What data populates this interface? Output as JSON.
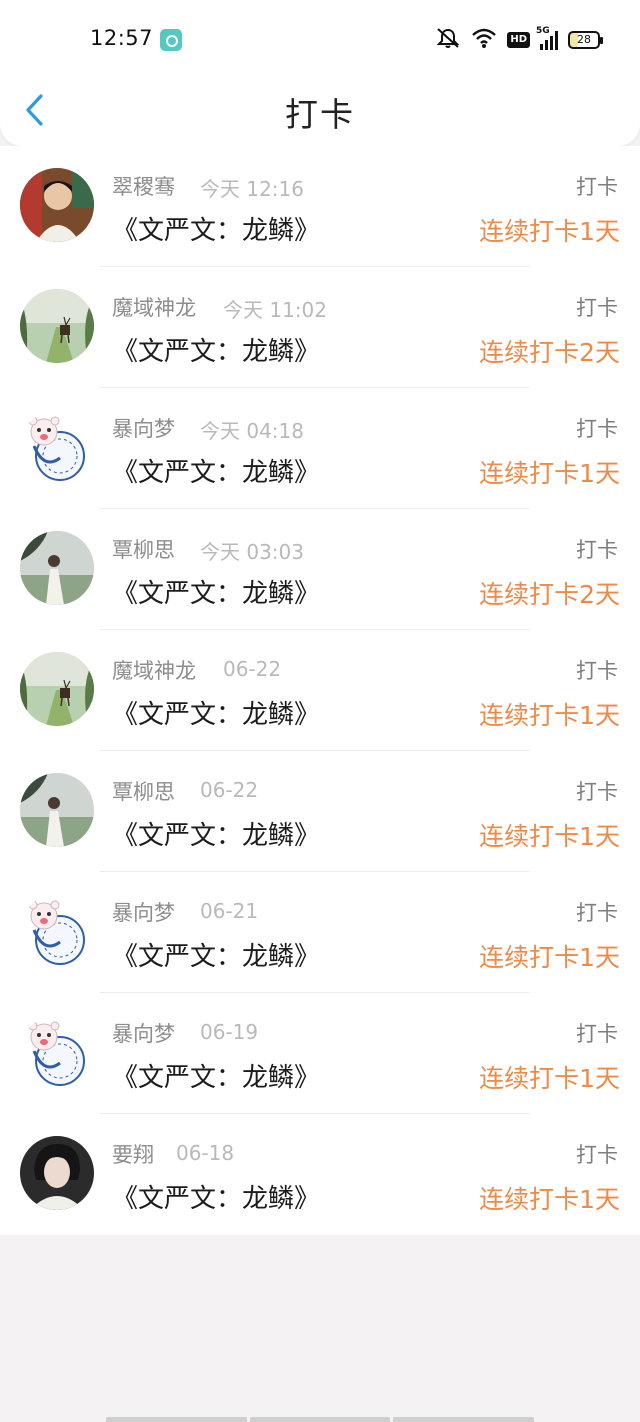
{
  "status_bar": {
    "time": "12:57",
    "network": "5G",
    "hd": "HD",
    "battery": "28",
    "icons": [
      "mute-icon",
      "wifi-icon",
      "hd-icon",
      "signal-icon",
      "battery-icon"
    ]
  },
  "header": {
    "title": "打卡",
    "back_icon": "chevron-left-icon"
  },
  "colors": {
    "accent": "#2a9bdf",
    "streak": "#ee8a48",
    "name": "#8d8d8d",
    "time": "#b9b9b9"
  },
  "entries": [
    {
      "name": "翠稷骞",
      "time": "今天 12:16",
      "title": "《文严文：龙鳞》",
      "action": "打卡",
      "streak": "连续打卡1天",
      "avatar": "photo-boy"
    },
    {
      "name": "魔域神龙",
      "time": "今天 11:02",
      "title": "《文严文：龙鳞》",
      "action": "打卡",
      "streak": "连续打卡2天",
      "avatar": "deer-forest"
    },
    {
      "name": "暴向梦",
      "time": "今天 04:18",
      "title": "《文严文：龙鳞》",
      "action": "打卡",
      "streak": "连续打卡1天",
      "avatar": "cartoon-pig"
    },
    {
      "name": "覃柳思",
      "time": "今天 03:03",
      "title": "《文严文：龙鳞》",
      "action": "打卡",
      "streak": "连续打卡2天",
      "avatar": "woman-field"
    },
    {
      "name": "魔域神龙",
      "time": "06-22",
      "title": "《文严文：龙鳞》",
      "action": "打卡",
      "streak": "连续打卡1天",
      "avatar": "deer-forest"
    },
    {
      "name": "覃柳思",
      "time": "06-22",
      "title": "《文严文：龙鳞》",
      "action": "打卡",
      "streak": "连续打卡1天",
      "avatar": "woman-field"
    },
    {
      "name": "暴向梦",
      "time": "06-21",
      "title": "《文严文：龙鳞》",
      "action": "打卡",
      "streak": "连续打卡1天",
      "avatar": "cartoon-pig"
    },
    {
      "name": "暴向梦",
      "time": "06-19",
      "title": "《文严文：龙鳞》",
      "action": "打卡",
      "streak": "连续打卡1天",
      "avatar": "cartoon-pig"
    },
    {
      "name": "要翔",
      "time": "06-18",
      "title": "《文严文：龙鳞》",
      "action": "打卡",
      "streak": "连续打卡1天",
      "avatar": "young-man"
    }
  ]
}
